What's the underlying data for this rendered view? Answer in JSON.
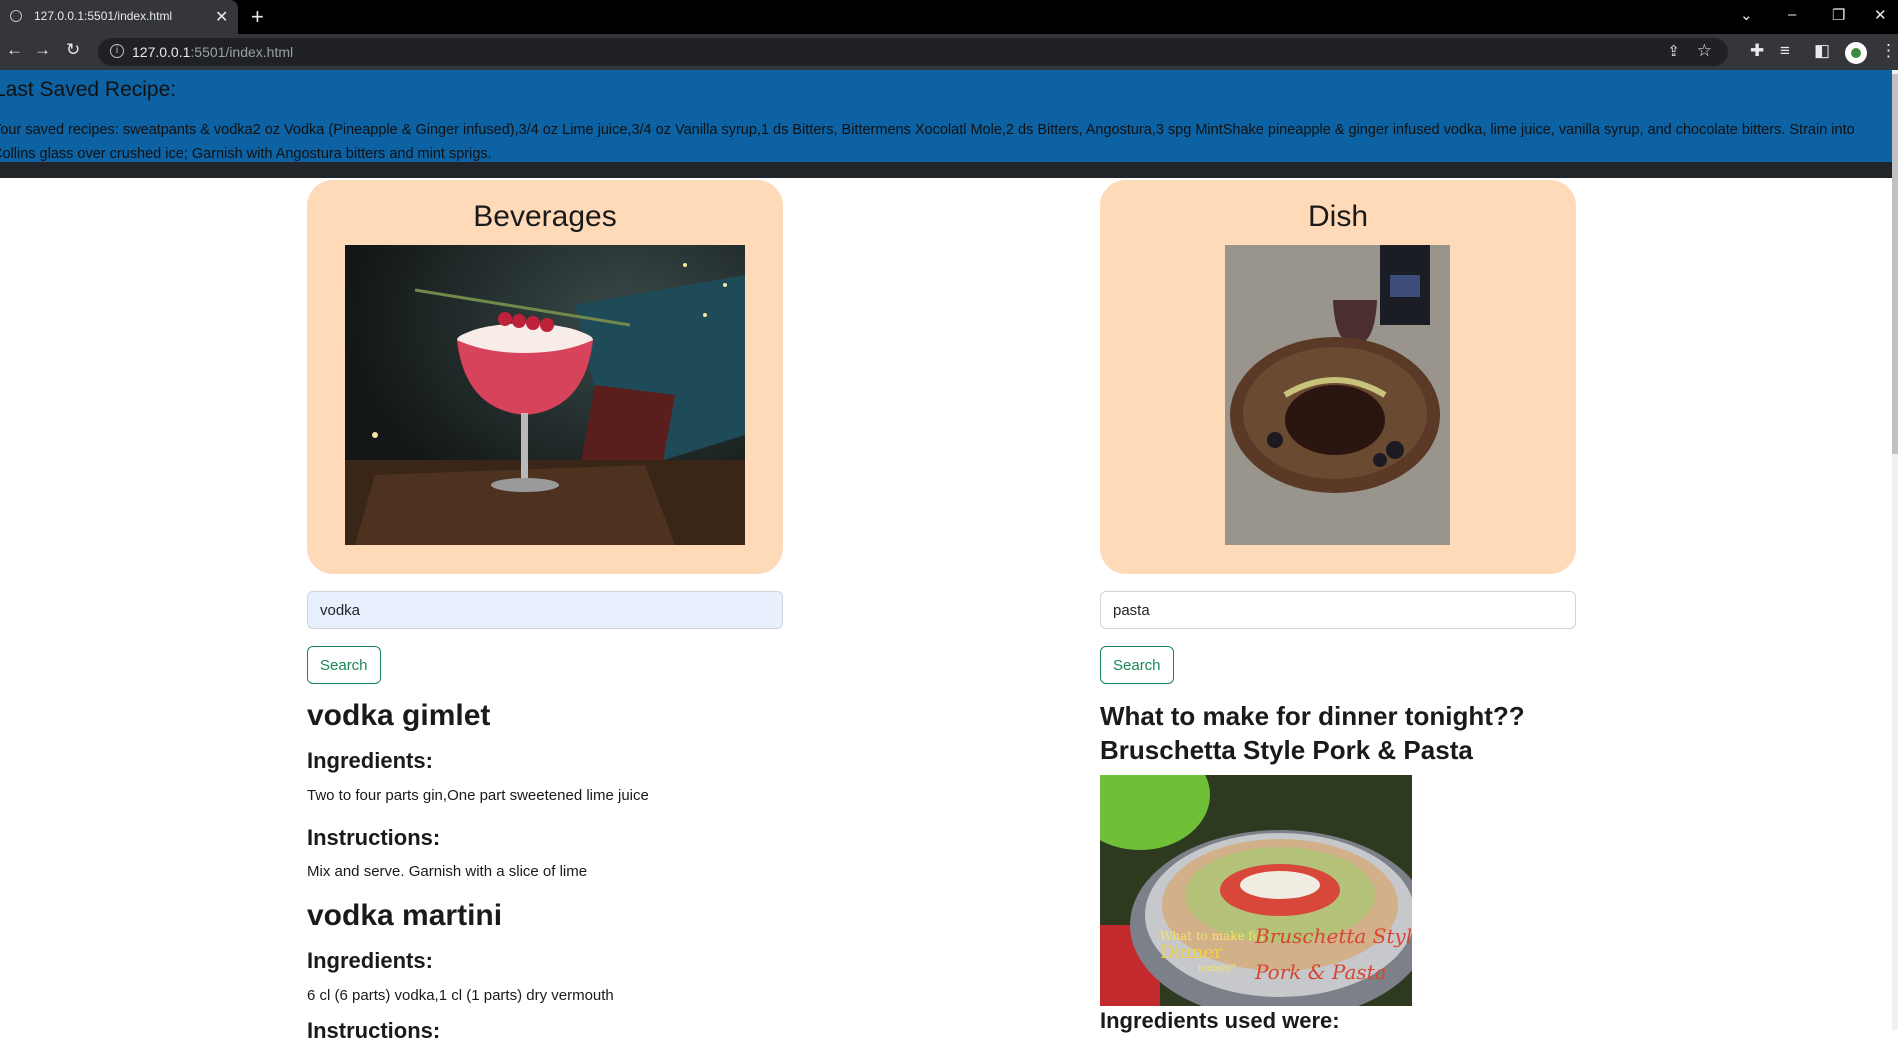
{
  "browser": {
    "tab_title": "127.0.0.1:5501/index.html",
    "url_host": "127.0.0.1",
    "url_rest": ":5501/index.html"
  },
  "saved": {
    "heading": "Last Saved Recipe:",
    "text": "Your saved recipes: sweatpants & vodka2 oz Vodka (Pineapple & Ginger infused),3/4 oz Lime juice,3/4 oz Vanilla syrup,1 ds Bitters, Bittermens Xocolatl Mole,2 ds Bitters, Angostura,3 spg MintShake pineapple & ginger infused vodka, lime juice, vanilla syrup, and chocolate bitters. Strain into Collins glass over crushed ice; Garnish with Angostura bitters and mint sprigs."
  },
  "beverages": {
    "title": "Beverages",
    "search_value": "vodka",
    "search_label": "Search",
    "results": [
      {
        "name": "vodka gimlet",
        "ingredients_label": "Ingredients:",
        "ingredients": "Two to four parts gin,One part sweetened lime juice",
        "instructions_label": "Instructions:",
        "instructions": "Mix and serve. Garnish with a slice of lime"
      },
      {
        "name": "vodka martini",
        "ingredients_label": "Ingredients:",
        "ingredients": "6 cl (6 parts) vodka,1 cl (1 parts) dry vermouth",
        "instructions_label": "Instructions:"
      }
    ]
  },
  "dish": {
    "title": "Dish",
    "search_value": "pasta",
    "search_label": "Search",
    "result_title_line1": "What to make for dinner tonight??",
    "result_title_line2": "Bruschetta Style Pork & Pasta",
    "image_caption_1": "What to make for",
    "image_caption_2": "Dinner",
    "image_caption_3": "tonight?",
    "image_caption_4": "Bruschetta Style",
    "image_caption_5": "Pork & Pasta",
    "ingredients_label": "Ingredients used were:"
  }
}
